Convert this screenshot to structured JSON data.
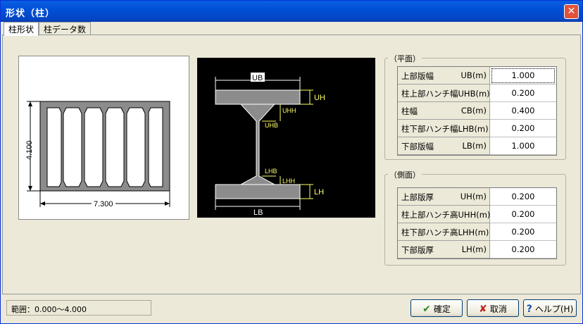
{
  "window": {
    "title": "形状（柱）",
    "close": "✕"
  },
  "tabs": [
    "柱形状",
    "柱データ数"
  ],
  "plan": {
    "height_dim": "4.100",
    "width_dim": "7.300"
  },
  "section_labels": {
    "UB": "UB",
    "UH": "UH",
    "UHH": "UHH",
    "UHB": "UHB",
    "LHB": "LHB",
    "LHH": "LHH",
    "LH": "LH",
    "LB": "LB"
  },
  "plane": {
    "legend": "（平面）",
    "rows": [
      {
        "label": "上部版幅",
        "sym": "UB(m)",
        "value": "1.000"
      },
      {
        "label": "柱上部ハンチ幅UHB(m)",
        "sym": "",
        "value": "0.200"
      },
      {
        "label": "柱幅",
        "sym": "CB(m)",
        "value": "0.400"
      },
      {
        "label": "柱下部ハンチ幅LHB(m)",
        "sym": "",
        "value": "0.200"
      },
      {
        "label": "下部版幅",
        "sym": "LB(m)",
        "value": "1.000"
      }
    ]
  },
  "side": {
    "legend": "（側面）",
    "rows": [
      {
        "label": "上部版厚",
        "sym": "UH(m)",
        "value": "0.200"
      },
      {
        "label": "柱上部ハンチ高UHH(m)",
        "sym": "",
        "value": "0.200"
      },
      {
        "label": "柱下部ハンチ高LHH(m)",
        "sym": "",
        "value": "0.200"
      },
      {
        "label": "下部版厚",
        "sym": "LH(m)",
        "value": "0.200"
      }
    ]
  },
  "status": "範囲：0.000～4.000",
  "buttons": {
    "ok": "確定",
    "cancel": "取消",
    "help": "ヘルプ(H)"
  },
  "icons": {
    "ok": "check-icon",
    "cancel": "x-icon",
    "help": "question-icon"
  },
  "colors": {
    "title_bar": "#0050d8",
    "section_bg": "#000000",
    "dim_yellow": "#ffff66"
  }
}
